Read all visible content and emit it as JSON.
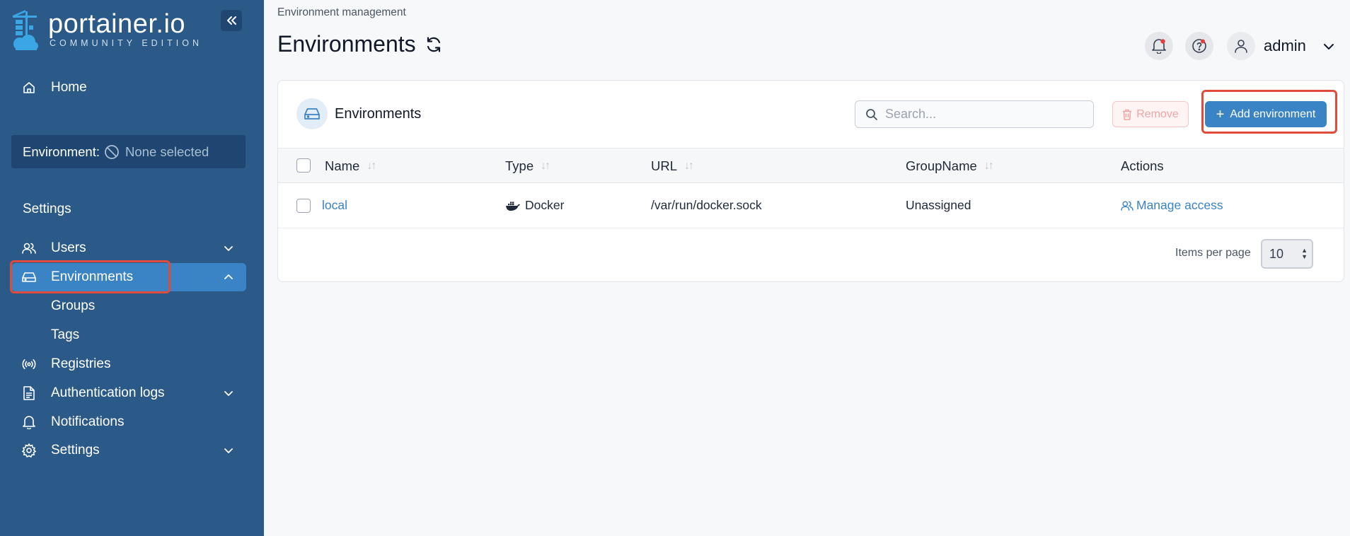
{
  "brand": {
    "name": "portainer.io",
    "edition": "COMMUNITY EDITION"
  },
  "sidebar": {
    "home_label": "Home",
    "environment_label": "Environment:",
    "environment_value": "None selected",
    "section_label": "Settings",
    "items": [
      {
        "label": "Users"
      },
      {
        "label": "Environments"
      },
      {
        "label": "Groups"
      },
      {
        "label": "Tags"
      },
      {
        "label": "Registries"
      },
      {
        "label": "Authentication logs"
      },
      {
        "label": "Notifications"
      },
      {
        "label": "Settings"
      }
    ]
  },
  "header": {
    "breadcrumb": "Environment management",
    "title": "Environments",
    "user": "admin"
  },
  "card": {
    "title": "Environments",
    "search_placeholder": "Search...",
    "remove_label": "Remove",
    "add_label": "Add environment",
    "columns": [
      "Name",
      "Type",
      "URL",
      "GroupName",
      "Actions"
    ],
    "rows": [
      {
        "name": "local",
        "type": "Docker",
        "url": "/var/run/docker.sock",
        "group": "Unassigned",
        "action": "Manage access"
      }
    ],
    "items_per_page_label": "Items per page",
    "items_per_page_value": "10"
  },
  "colors": {
    "sidebar_bg": "#2b5a88",
    "accent": "#3a83c4",
    "highlight": "#e04b3c"
  }
}
